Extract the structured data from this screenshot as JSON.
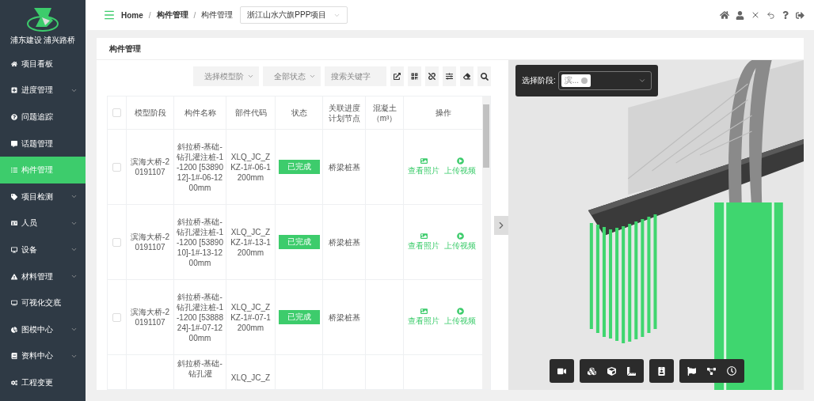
{
  "sidebar": {
    "brand": "浦东建设 浦兴路桥",
    "items": [
      {
        "label": "项目看板",
        "has_children": false,
        "selected": false
      },
      {
        "label": "进度管理",
        "has_children": true,
        "selected": false
      },
      {
        "label": "问题追踪",
        "has_children": false,
        "selected": false
      },
      {
        "label": "话题管理",
        "has_children": false,
        "selected": false
      },
      {
        "label": "构件管理",
        "has_children": false,
        "selected": true
      },
      {
        "label": "项目检测",
        "has_children": true,
        "selected": false
      },
      {
        "label": "人员",
        "has_children": true,
        "selected": false
      },
      {
        "label": "设备",
        "has_children": true,
        "selected": false
      },
      {
        "label": "材料管理",
        "has_children": true,
        "selected": false
      },
      {
        "label": "可视化交底",
        "has_children": false,
        "selected": false
      },
      {
        "label": "图模中心",
        "has_children": true,
        "selected": false
      },
      {
        "label": "资料中心",
        "has_children": true,
        "selected": false
      },
      {
        "label": "工程变更",
        "has_children": false,
        "selected": false
      }
    ]
  },
  "header": {
    "breadcrumb": [
      "Home",
      "构件管理",
      "构件管理"
    ],
    "separator": "/",
    "project_select": "浙江山水六旗PPP项目"
  },
  "page_title": "构件管理",
  "filters": {
    "stage_select": "选择模型阶",
    "status_select": "全部状态",
    "search": {
      "placeholder": "搜索关键字"
    }
  },
  "table": {
    "columns": [
      "模型阶段",
      "构件名称",
      "部件代码",
      "状态",
      "关联进度计划节点",
      "混凝土（m³）",
      "操作"
    ],
    "header_checked": false,
    "rows": [
      {
        "checked": false,
        "stage": "滨海大桥-20191107",
        "name": "斜拉桥-基础-钻孔灌注桩-1-1200 [5389012]-1#-06-1200mm",
        "code": "XLQ_JC_ZKZ-1#-06-1200mm",
        "status": "已完成",
        "node": "桥梁桩基",
        "actions": [
          "查看照片",
          "上传视频"
        ]
      },
      {
        "checked": false,
        "stage": "滨海大桥-20191107",
        "name": "斜拉桥-基础-钻孔灌注桩-1-1200 [5389010]-1#-13-1200mm",
        "code": "XLQ_JC_ZKZ-1#-13-1200mm",
        "status": "已完成",
        "node": "桥梁桩基",
        "actions": [
          "查看照片",
          "上传视频"
        ]
      },
      {
        "checked": false,
        "stage": "滨海大桥-20191107",
        "name": "斜拉桥-基础-钻孔灌注桩-1-1200 [5388824]-1#-07-1200mm",
        "code": "XLQ_JC_ZKZ-1#-07-1200mm",
        "status": "已完成",
        "node": "桥梁桩基",
        "actions": [
          "查看照片",
          "上传视频"
        ]
      },
      {
        "name": "斜拉桥-基础-钻孔灌",
        "code": "XLQ_JC_Z"
      }
    ]
  },
  "viewer": {
    "stage_label": "选择阶段:",
    "stage_tag": "滨..."
  }
}
